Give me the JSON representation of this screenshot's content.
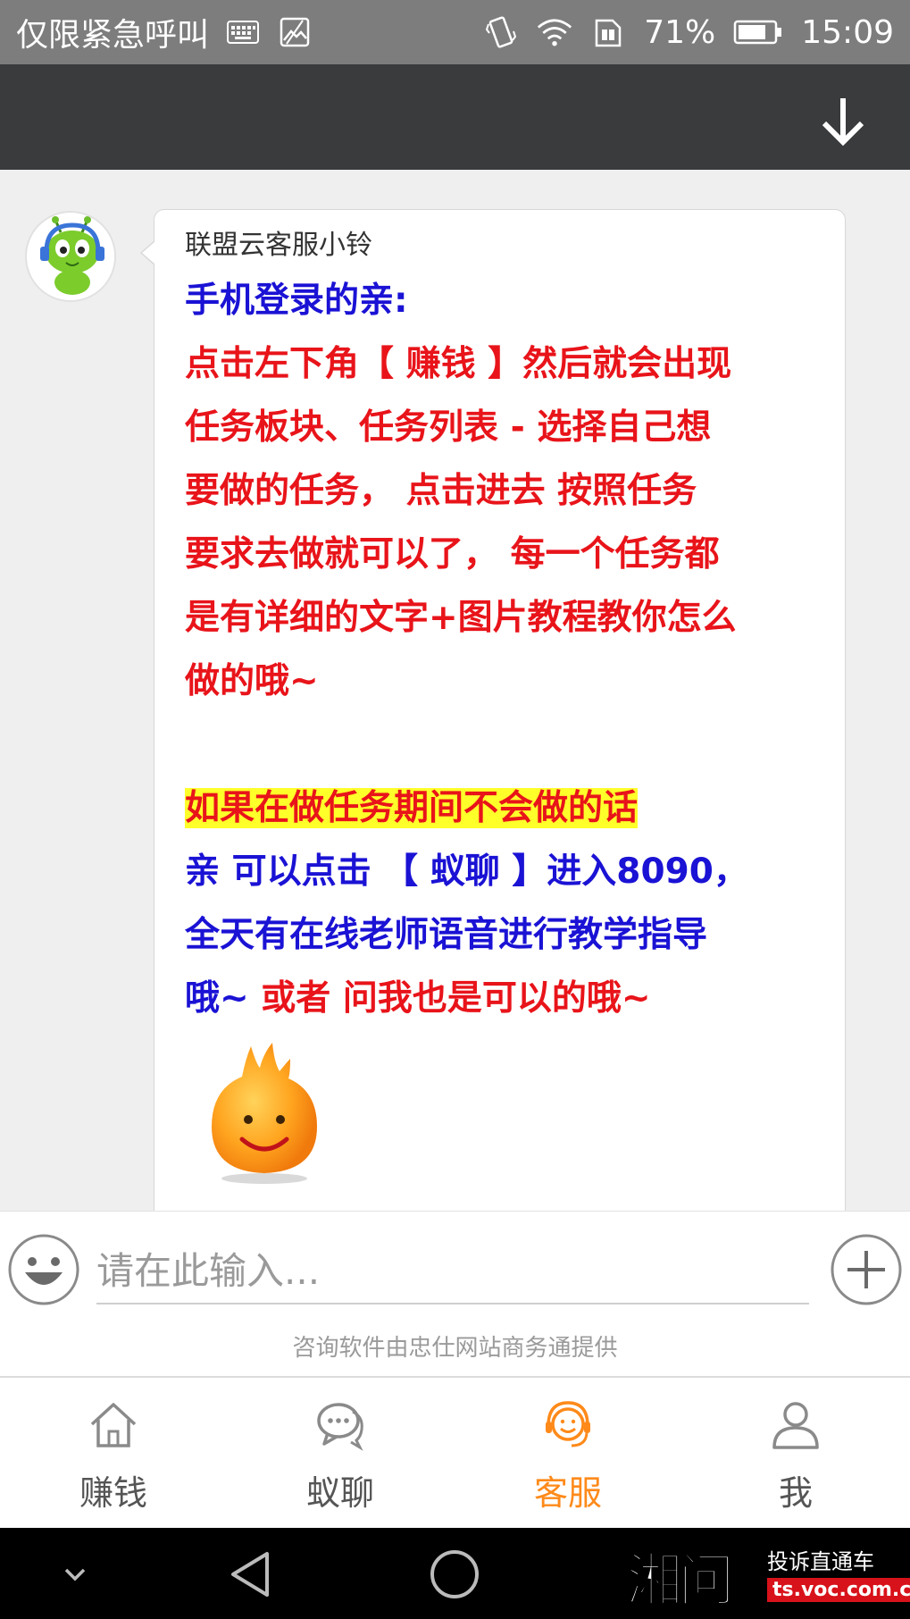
{
  "status_bar": {
    "carrier": "仅限紧急呼叫",
    "battery": "71%",
    "time": "15:09"
  },
  "chat": {
    "sender": "联盟云客服小铃",
    "lines": [
      "手机登录的亲:",
      "点击左下角【 赚钱 】然后就会出现",
      "任务板块、任务列表 - 选择自己想",
      "要做的任务， 点击进去   按照任务",
      "要求去做就可以了， 每一个任务都",
      "是有详细的文字+图片教程教你怎么",
      "做的哦~",
      "",
      "如果在做任务期间不会做的话",
      "亲 可以点击 【  蚁聊  】进入8090，",
      "全天有在线老师语音进行教学指导",
      "哦~",
      "或者 问我也是可以的哦~"
    ]
  },
  "input": {
    "placeholder": "请在此输入...",
    "powered_by": "咨询软件由忠仕网站商务通提供"
  },
  "tabs": [
    {
      "label": "赚钱",
      "icon": "home-icon",
      "active": false
    },
    {
      "label": "蚁聊",
      "icon": "chat-bubbles-icon",
      "active": false
    },
    {
      "label": "客服",
      "icon": "customer-service-icon",
      "active": true
    },
    {
      "label": "我",
      "icon": "user-icon",
      "active": false
    }
  ],
  "watermark": {
    "logo": "湘问",
    "text": "投诉直通车",
    "url": "ts.voc.com.cn"
  },
  "colors": {
    "accent": "#ff8a1a",
    "blue_text": "#1a12d4",
    "red_text": "#e8141a",
    "highlight": "#ffff2a",
    "header": "#3a3b3c"
  }
}
